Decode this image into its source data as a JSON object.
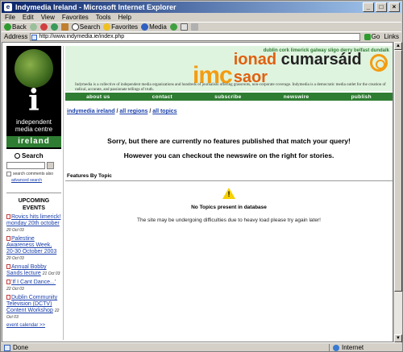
{
  "window": {
    "title": "Indymedia Ireland - Microsoft Internet Explorer",
    "controls": [
      "_",
      "□",
      "×"
    ]
  },
  "menu": [
    "File",
    "Edit",
    "View",
    "Favorites",
    "Tools",
    "Help"
  ],
  "toolbar": {
    "back": "Back",
    "search": "Search",
    "favorites": "Favorites",
    "media": "Media"
  },
  "address": {
    "label": "Address",
    "url": "http://www.indymedia.ie/index.php",
    "go": "Go",
    "links": "Links"
  },
  "status": {
    "text": "Done",
    "zone": "Internet"
  },
  "logo": {
    "letter": "i",
    "line1": "independent",
    "line2": "media centre",
    "line3": "ireland"
  },
  "search": {
    "title": "Search",
    "check_label": "search comments also",
    "advanced": "advanced search"
  },
  "events": {
    "title": "UPCOMING EVENTS",
    "items": [
      {
        "title": "Rovics hits limerick! monday 20th october",
        "date": "20 Oct 03"
      },
      {
        "title": "Palestine Awareness Week, 20-30 October 2003",
        "date": "20 Oct 03"
      },
      {
        "title": "Annual Bobby Sands lecture",
        "date": "21 Oct 03"
      },
      {
        "title": "'If I Cant Dance...'",
        "date": "22 Oct 03"
      },
      {
        "title": "Dublin Community Television (DCTV) Content Workshop",
        "date": "22 Oct 03"
      }
    ],
    "calendar": "event calendar >>"
  },
  "header": {
    "cities": "dublin cork limerick galway sligo derry belfast dundalk",
    "imc": "imc",
    "name_a": "ionad ",
    "name_b": "cumarsáid",
    "name_c": " saor",
    "tagline": "Indymedia is a collective of independent media organizations and hundreds of journalists offering grassroots, non-corporate coverage. Indymedia is a democratic media outlet for the creation of radical, accurate, and passionate tellings of truth."
  },
  "nav": [
    "about us",
    "contact",
    "subscribe",
    "newswire",
    "publish"
  ],
  "breadcrumb": {
    "a": "indymedia ireland",
    "b": "all regions",
    "c": "all topics",
    "sep": " / "
  },
  "main": {
    "message1": "Sorry, but there are currently no features published that match your query!",
    "message2": "However you can checkout the newswire on the right for stories.",
    "section_title": "Features By Topic",
    "warn_symbol": "!",
    "no_topics": "No Topics present in database",
    "difficulty": "The site may be undergoing difficulties due to heavy load please try again later!"
  },
  "colors": {
    "accent_green": "#2e7d32",
    "brand_orange": "#f39c12",
    "link_blue": "#1a3faa"
  }
}
